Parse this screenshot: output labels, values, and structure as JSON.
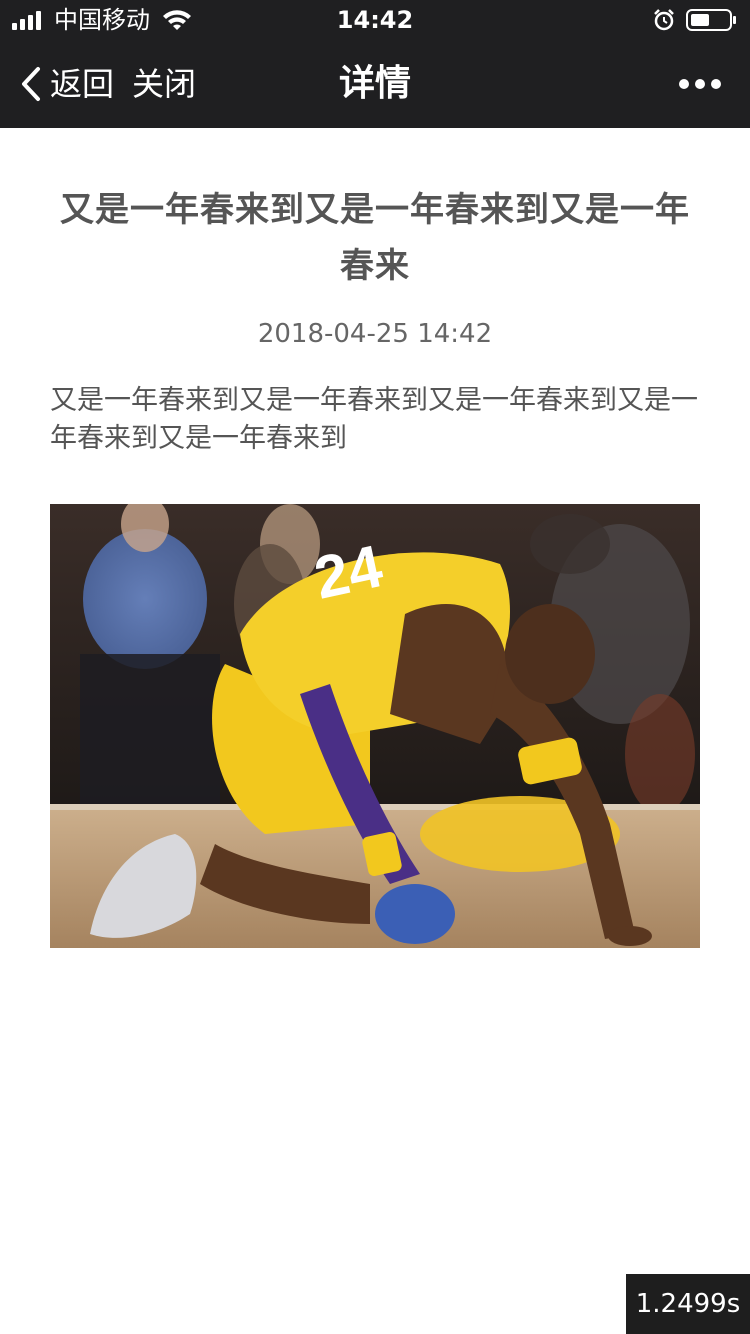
{
  "status_bar": {
    "carrier": "中国移动",
    "time": "14:42",
    "icons": [
      "signal-icon",
      "wifi-icon",
      "alarm-icon",
      "battery-icon"
    ]
  },
  "nav_bar": {
    "back_label": "返回",
    "close_label": "关闭",
    "title": "详情",
    "more_icon": "more-icon"
  },
  "article": {
    "title": "又是一年春来到又是一年春来到又是一年春来",
    "date": "2018-04-25 14:42",
    "body": "又是一年春来到又是一年春来到又是一年春来到又是一年春来到又是一年春来到",
    "image": {
      "description_icon": "photo-basketball-player"
    }
  },
  "overlay": {
    "timing": "1.2499s"
  },
  "colors": {
    "nav_background": "#1f1f21",
    "title_text": "#555555",
    "date_text": "#666666",
    "jersey_yellow": "#f2c81e",
    "jersey_purple": "#4a2f86"
  }
}
